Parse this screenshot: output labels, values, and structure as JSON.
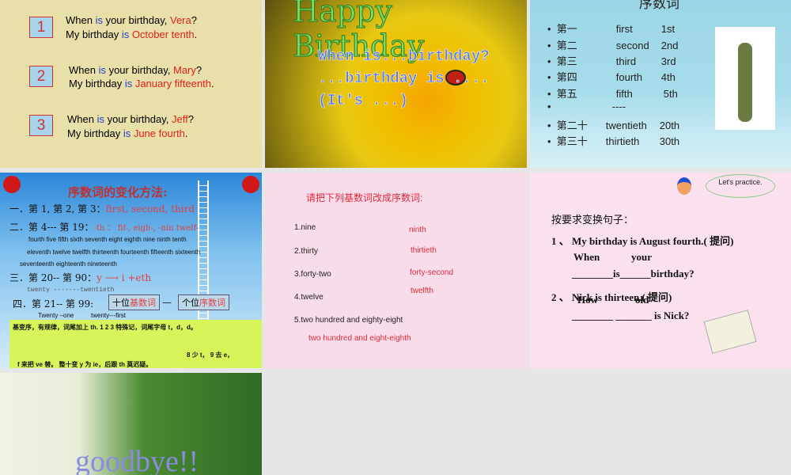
{
  "slides": [
    {
      "items": [
        {
          "num": "1",
          "l1a": "When ",
          "l1b": "is",
          "l1c": " your birthday, ",
          "l1d": "Vera",
          "l1e": "?",
          "l2a": "My birthday ",
          "l2b": "is",
          "l2c": " October tenth",
          "l2d": "."
        },
        {
          "num": "2",
          "l1a": "When ",
          "l1b": "is",
          "l1c": " your birthday, ",
          "l1d": "Mary",
          "l1e": "?",
          "l2a": "My birthday ",
          "l2b": "is",
          "l2c": " January fifteenth",
          "l2d": "."
        },
        {
          "num": "3",
          "l1a": "When ",
          "l1b": "is",
          "l1c": " your birthday, ",
          "l1d": "Jeff",
          "l1e": "?",
          "l2a": "My birthday ",
          "l2b": "is",
          "l2c": " June fourth",
          "l2d": "."
        }
      ]
    },
    {
      "title": "Happy Birthday",
      "lines": [
        "When is...birthday?",
        "...birthday is ....",
        "(It's ...)"
      ]
    },
    {
      "title": "序数词",
      "rows": [
        [
          "第一",
          "first",
          "1st"
        ],
        [
          "第二",
          "second",
          "2nd"
        ],
        [
          "第三",
          "third",
          "3rd"
        ],
        [
          "第四",
          "fourth",
          "4th"
        ],
        [
          "第五",
          "fifth",
          "5th"
        ],
        [
          "",
          "----",
          ""
        ],
        [
          "第二十",
          "twentieth",
          "20th"
        ],
        [
          "第三十",
          "thirtieth",
          "30th"
        ]
      ]
    },
    {
      "title": "序数词的变化方法:",
      "r1a": "一．第 1, 第 2, 第 3：",
      "r1b": "first, second, third",
      "r2a": "二．第 4--- 第 19：",
      "r2b": "-th ：  fif-, eigh-, -nin  twelf-",
      "words1": "fourth  five fifth  sixth  seventh  eight eighth  nine ninth  tenth",
      "words2": "eleventh  twelve twelfth  thirteenth  fourteenth  fifteenth  sixteenth",
      "words3": "seventeenth  eighteenth  nineteenth",
      "r3a": "三．第 20-- 第 90：",
      "r3b": "y  ⟶   i  +eth",
      "ex3": "twenty  -------twentieth",
      "r4a": "四．第 21-- 第 99:",
      "box1a": "十位",
      "box1b": "基数词",
      "dash": "—",
      "box2a": "个位",
      "box2b": "序数词",
      "ex4a": "Twenty –one",
      "ex4b": "twenty---first",
      "rhyme1": "基变序，有规律，词尾加上 th.    1 2 3  特殊记，词尾字母 t，d，d。",
      "rhyme2": "8 少 t，  9 去  e，",
      "rhyme3": "f 来把 ve 替。   整十变 y 为 ie，后跟 th 莫迟疑。"
    },
    {
      "title": "请把下列基数词改成序数词:",
      "qs": [
        "1.nine",
        "2.thirty",
        "3.forty-two",
        "4.twelve",
        "5.two hundred and eighty-eight"
      ],
      "as": [
        "ninth",
        "thirtieth",
        "forty-second",
        "twelfth",
        "two hundred and eight-eighth"
      ]
    },
    {
      "bubble": "Let's practice.",
      "head": "按要求变换句子：",
      "q1": "1 、 My   birthday  is  August  fourth.( 提问)",
      "a1a": "When",
      "a1b": "your",
      "l1": "________is______birthday?",
      "q2": "2 、 Nick   is    thirteen.( 提问)",
      "a2a": "How",
      "a2b": "old",
      "l2": "________  _______ is Nick?"
    },
    {
      "title": "goodbye!!"
    }
  ]
}
